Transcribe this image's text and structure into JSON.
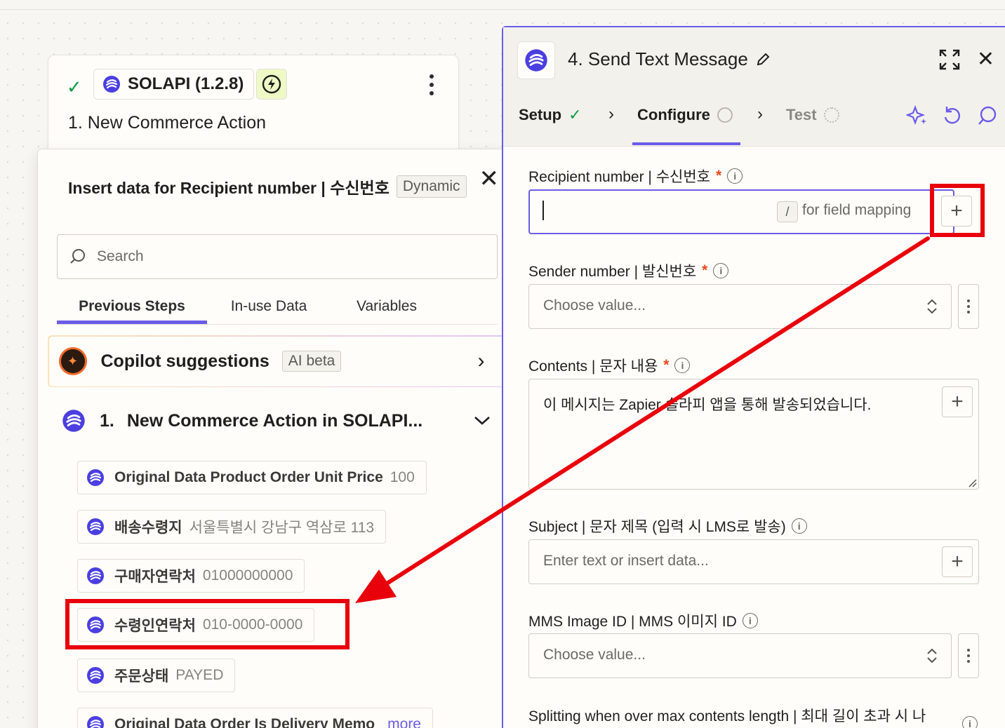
{
  "trigger": {
    "app_name": "SOLAPI (1.2.8)",
    "title": "1. New Commerce Action"
  },
  "picker": {
    "title": "Insert data for Recipient number | 수신번호",
    "badge": "Dynamic",
    "search_placeholder": "Search",
    "tabs": [
      "Previous Steps",
      "In-use Data",
      "Variables"
    ],
    "copilot": {
      "label": "Copilot suggestions",
      "badge": "AI beta"
    },
    "step": {
      "number": "1.",
      "name": "New Commerce Action in SOLAPI..."
    },
    "fields": [
      {
        "name": "Original Data Product Order Unit Price",
        "value": "100"
      },
      {
        "name": "배송수령지",
        "value": "서울특별시 강남구 역삼로 113"
      },
      {
        "name": "구매자연락처",
        "value": "01000000000"
      },
      {
        "name": "수령인연락처",
        "value": "010-0000-0000"
      },
      {
        "name": "주문상태",
        "value": "PAYED"
      },
      {
        "name": "Original Data Order Is Delivery Memo",
        "value": "more"
      }
    ]
  },
  "config": {
    "title": "4. Send Text Message",
    "nav": {
      "setup": "Setup",
      "configure": "Configure",
      "test": "Test"
    },
    "fields": {
      "recipient": {
        "label": "Recipient number | 수신번호",
        "hint": "for field mapping",
        "key": "/"
      },
      "sender": {
        "label": "Sender number | 발신번호",
        "placeholder": "Choose value..."
      },
      "contents": {
        "label": "Contents | 문자 내용",
        "value": "이 메시지는 Zapier 솔라피 앱을 통해 발송되었습니다."
      },
      "subject": {
        "label": "Subject | 문자 제목 (입력 시 LMS로 발송)",
        "placeholder": "Enter text or insert data..."
      },
      "mms": {
        "label": "MMS Image ID | MMS 이미지 ID",
        "placeholder": "Choose value..."
      },
      "splitting": {
        "label": "Splitting when over max contents length | 최대 길이 초과 시 나"
      }
    },
    "required_mark": "*"
  },
  "colors": {
    "accent": "#6a5ce8",
    "annotation_red": "#e8000b",
    "success_green": "#139a43",
    "required_orange": "#e8491e"
  }
}
